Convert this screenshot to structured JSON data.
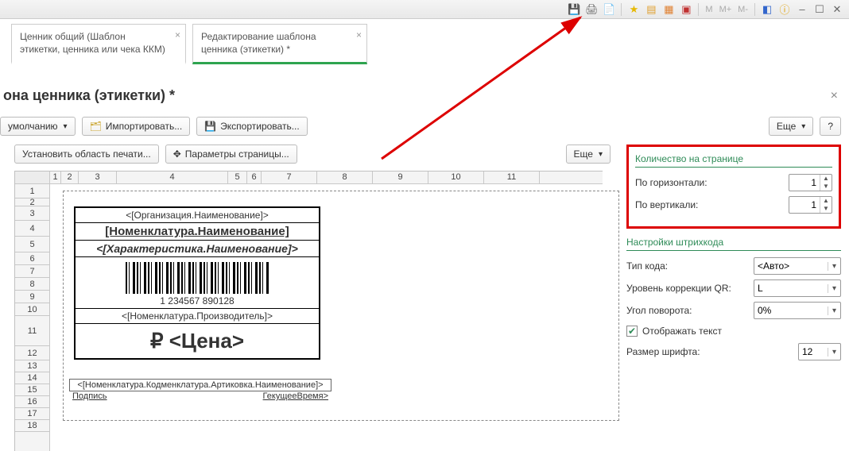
{
  "toolbar_icons": {},
  "tabs": [
    {
      "label": "Ценник общий (Шаблон этикетки, ценника или чека ККМ)",
      "active": false
    },
    {
      "label": "Редактирование шаблона ценника (этикетки) *",
      "active": true
    }
  ],
  "page_title": "она ценника (этикетки) *",
  "buttons": {
    "default": "умолчанию",
    "import": "Импортировать...",
    "export": "Экспортировать...",
    "more": "Еще",
    "help": "?",
    "set_print_area": "Установить область печати...",
    "page_params": "Параметры страницы..."
  },
  "columns": [
    "1",
    "2",
    "3",
    "4",
    "5",
    "6",
    "7",
    "8",
    "9",
    "10",
    "11"
  ],
  "rows": [
    "1",
    "2",
    "3",
    "4",
    "5",
    "6",
    "7",
    "8",
    "9",
    "10",
    "11",
    "12",
    "13",
    "14",
    "15",
    "16",
    "17",
    "18"
  ],
  "label_template": {
    "org": "<[Организация.Наименование]>",
    "nomname": "[Номенклатура.Наименование]",
    "characteristic": "<[Характеристика.Наименование]>",
    "barcode_value": "1 234567 890128",
    "producer": "<[Номенклатура.Производитель]>",
    "price": "₽ <Цена>",
    "extra_row": "<[Номенклатура.Кодменклатура.Артиковка.Наименование]>",
    "sign": "Подпись",
    "time": "ГекущееВремя>"
  },
  "right_panel": {
    "count_title": "Количество на странице",
    "horizontal_label": "По горизонтали:",
    "horizontal_value": "1",
    "vertical_label": "По вертикали:",
    "vertical_value": "1",
    "barcode_title": "Настройки штрихкода",
    "code_type_label": "Тип кода:",
    "code_type_value": "<Авто>",
    "qr_level_label": "Уровень коррекции QR:",
    "qr_level_value": "L",
    "angle_label": "Угол поворота:",
    "angle_value": "0%",
    "show_text_label": "Отображать текст",
    "show_text_checked": true,
    "font_size_label": "Размер шрифта:",
    "font_size_value": "12"
  }
}
